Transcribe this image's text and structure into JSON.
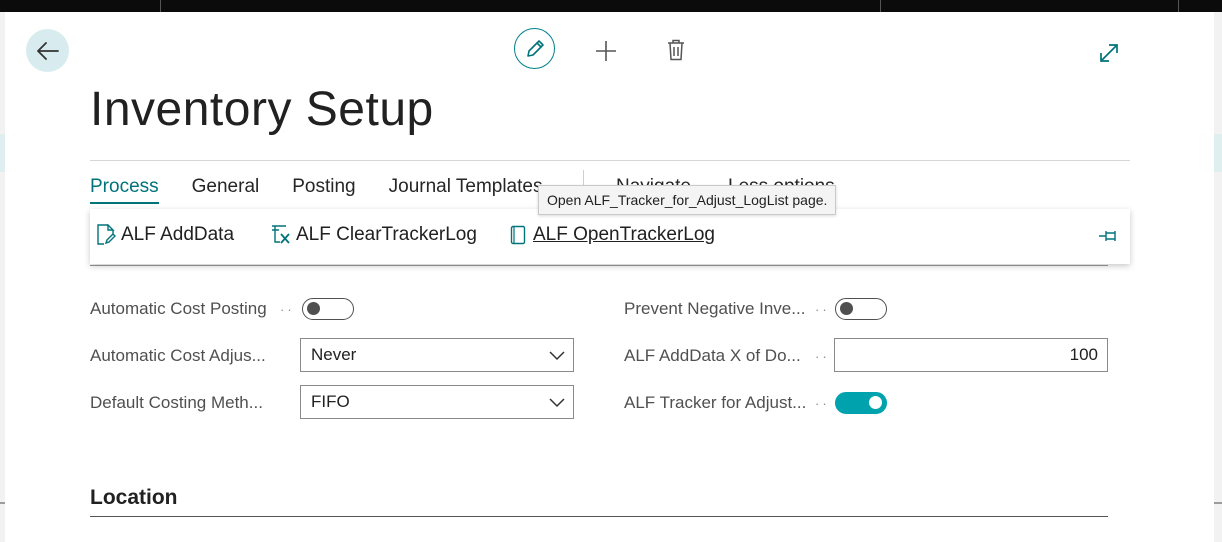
{
  "header": {
    "title": "Inventory Setup"
  },
  "icons": {
    "back": "back-arrow-icon",
    "edit": "pencil-icon",
    "new": "plus-icon",
    "delete": "trash-icon",
    "expand": "expand-icon",
    "pin": "pin-icon"
  },
  "colors": {
    "accent": "#00737b",
    "toggle_on": "#00a3ad"
  },
  "action_bar": {
    "tabs": [
      {
        "label": "Process",
        "active": true
      },
      {
        "label": "General",
        "active": false
      },
      {
        "label": "Posting",
        "active": false
      },
      {
        "label": "Journal Templates",
        "active": false
      }
    ],
    "hidden_tabs": [
      {
        "label": "Navigate"
      },
      {
        "label": "Less options"
      }
    ],
    "process_items": [
      {
        "label": "ALF AddData",
        "icon": "document-edit-icon"
      },
      {
        "label": "ALF ClearTrackerLog",
        "icon": "clear-list-icon"
      },
      {
        "label": "ALF OpenTrackerLog",
        "icon": "page-icon"
      }
    ],
    "tooltip": "Open ALF_Tracker_for_Adjust_LogList page."
  },
  "fields": {
    "left": [
      {
        "label": "Automatic Cost Posting",
        "type": "toggle",
        "value": false
      },
      {
        "label": "Automatic Cost Adjus...",
        "type": "select",
        "value": "Never"
      },
      {
        "label": "Default Costing Meth...",
        "type": "select",
        "value": "FIFO"
      }
    ],
    "right": [
      {
        "label": "Prevent Negative Inve...",
        "type": "toggle",
        "value": false
      },
      {
        "label": "ALF AddData X of Do...",
        "type": "number",
        "value": "100"
      },
      {
        "label": "ALF Tracker for Adjust...",
        "type": "toggle",
        "value": true
      }
    ]
  },
  "sections": [
    {
      "title": "Location"
    }
  ]
}
